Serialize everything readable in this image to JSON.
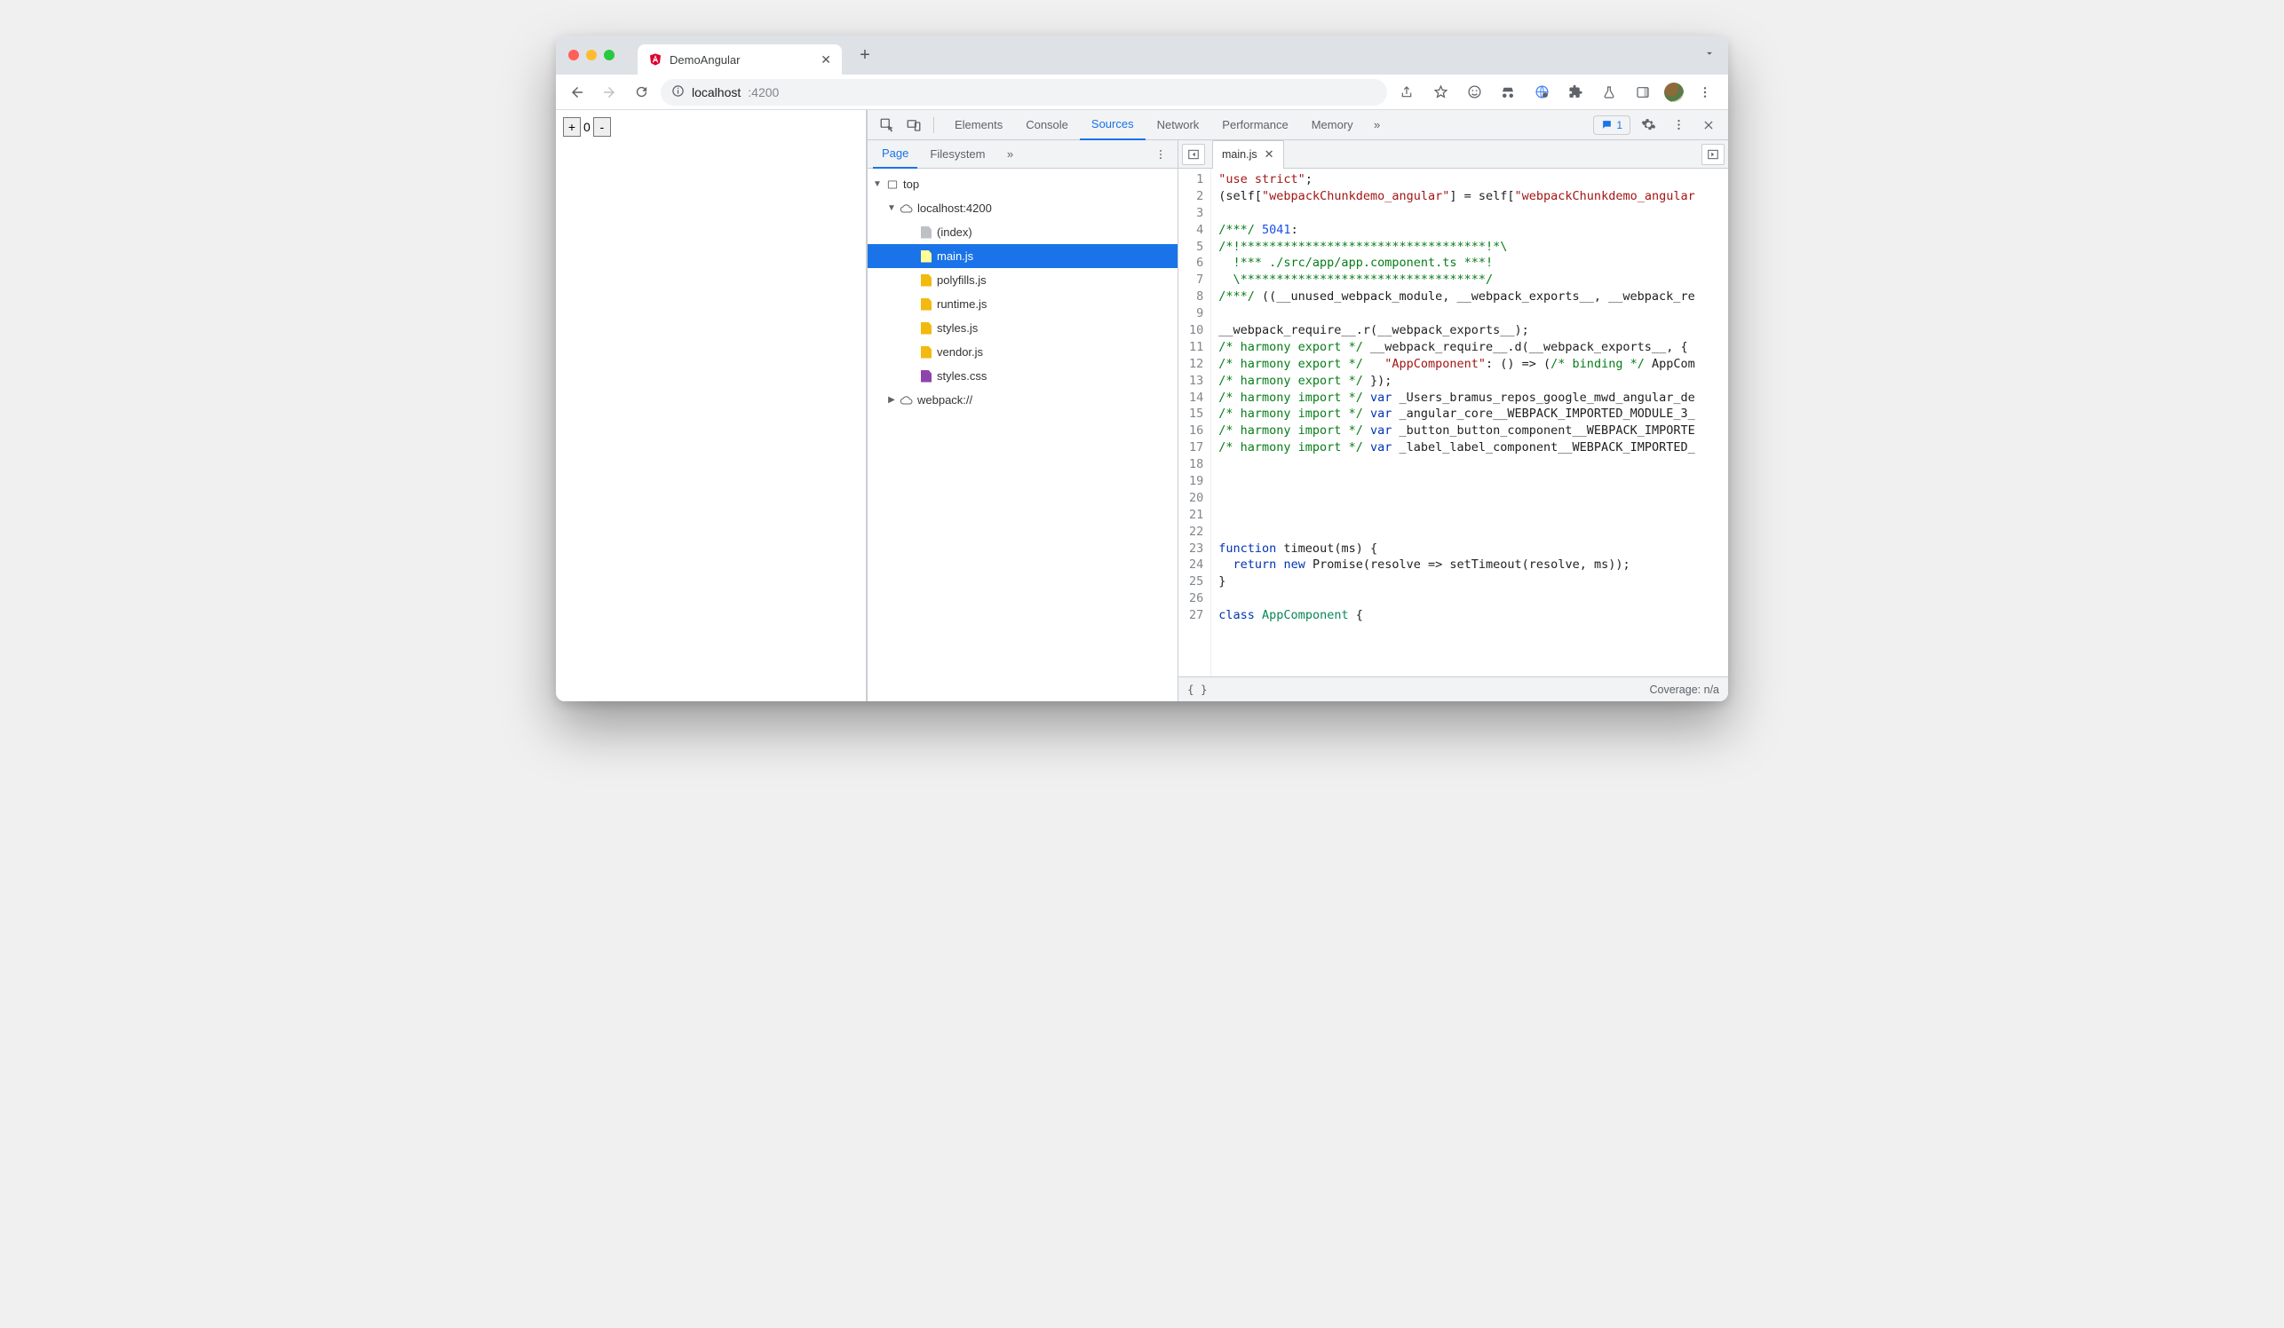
{
  "browser": {
    "tab_title": "DemoAngular",
    "url_host": "localhost",
    "url_port": ":4200"
  },
  "page": {
    "counter_value": "0"
  },
  "devtools": {
    "tabs": [
      "Elements",
      "Console",
      "Sources",
      "Network",
      "Performance",
      "Memory"
    ],
    "active_tab": "Sources",
    "message_count": "1",
    "nav": {
      "tabs": [
        "Page",
        "Filesystem"
      ],
      "active": "Page",
      "tree": {
        "top": "top",
        "origin": "localhost:4200",
        "files": [
          {
            "name": "(index)",
            "kind": "doc"
          },
          {
            "name": "main.js",
            "kind": "js",
            "selected": true
          },
          {
            "name": "polyfills.js",
            "kind": "js"
          },
          {
            "name": "runtime.js",
            "kind": "js"
          },
          {
            "name": "styles.js",
            "kind": "js"
          },
          {
            "name": "vendor.js",
            "kind": "js"
          },
          {
            "name": "styles.css",
            "kind": "css"
          }
        ],
        "webpack": "webpack://"
      }
    },
    "editor": {
      "open_file": "main.js",
      "coverage": "Coverage: n/a",
      "code": [
        {
          "n": 1,
          "segs": [
            {
              "t": "\"use strict\"",
              "c": "str"
            },
            {
              "t": ";",
              "c": "id"
            }
          ]
        },
        {
          "n": 2,
          "segs": [
            {
              "t": "(self[",
              "c": "id"
            },
            {
              "t": "\"webpackChunkdemo_angular\"",
              "c": "str"
            },
            {
              "t": "] = self[",
              "c": "id"
            },
            {
              "t": "\"webpackChunkdemo_angular",
              "c": "str"
            }
          ]
        },
        {
          "n": 3,
          "segs": []
        },
        {
          "n": 4,
          "segs": [
            {
              "t": "/***/",
              "c": "cmt"
            },
            {
              "t": " ",
              "c": "id"
            },
            {
              "t": "5041",
              "c": "num"
            },
            {
              "t": ":",
              "c": "id"
            }
          ]
        },
        {
          "n": 5,
          "segs": [
            {
              "t": "/*!**********************************!*\\",
              "c": "cmt"
            }
          ]
        },
        {
          "n": 6,
          "segs": [
            {
              "t": "  !*** ./src/app/app.component.ts ***!",
              "c": "cmt"
            }
          ]
        },
        {
          "n": 7,
          "segs": [
            {
              "t": "  \\**********************************/",
              "c": "cmt"
            }
          ]
        },
        {
          "n": 8,
          "segs": [
            {
              "t": "/***/",
              "c": "cmt"
            },
            {
              "t": " ((__unused_webpack_module, __webpack_exports__, __webpack_re",
              "c": "id"
            }
          ]
        },
        {
          "n": 9,
          "segs": []
        },
        {
          "n": 10,
          "segs": [
            {
              "t": "__webpack_require__.r(__webpack_exports__);",
              "c": "id"
            }
          ]
        },
        {
          "n": 11,
          "segs": [
            {
              "t": "/* harmony export */",
              "c": "cmt"
            },
            {
              "t": " __webpack_require__.d(__webpack_exports__, {",
              "c": "id"
            }
          ]
        },
        {
          "n": 12,
          "segs": [
            {
              "t": "/* harmony export */",
              "c": "cmt"
            },
            {
              "t": "   ",
              "c": "id"
            },
            {
              "t": "\"AppComponent\"",
              "c": "str"
            },
            {
              "t": ": () => (",
              "c": "id"
            },
            {
              "t": "/* binding */",
              "c": "cmt"
            },
            {
              "t": " AppCom",
              "c": "id"
            }
          ]
        },
        {
          "n": 13,
          "segs": [
            {
              "t": "/* harmony export */",
              "c": "cmt"
            },
            {
              "t": " });",
              "c": "id"
            }
          ]
        },
        {
          "n": 14,
          "segs": [
            {
              "t": "/* harmony import */",
              "c": "cmt"
            },
            {
              "t": " ",
              "c": "id"
            },
            {
              "t": "var",
              "c": "kw"
            },
            {
              "t": " _Users_bramus_repos_google_mwd_angular_de",
              "c": "id"
            }
          ]
        },
        {
          "n": 15,
          "segs": [
            {
              "t": "/* harmony import */",
              "c": "cmt"
            },
            {
              "t": " ",
              "c": "id"
            },
            {
              "t": "var",
              "c": "kw"
            },
            {
              "t": " _angular_core__WEBPACK_IMPORTED_MODULE_3_",
              "c": "id"
            }
          ]
        },
        {
          "n": 16,
          "segs": [
            {
              "t": "/* harmony import */",
              "c": "cmt"
            },
            {
              "t": " ",
              "c": "id"
            },
            {
              "t": "var",
              "c": "kw"
            },
            {
              "t": " _button_button_component__WEBPACK_IMPORTE",
              "c": "id"
            }
          ]
        },
        {
          "n": 17,
          "segs": [
            {
              "t": "/* harmony import */",
              "c": "cmt"
            },
            {
              "t": " ",
              "c": "id"
            },
            {
              "t": "var",
              "c": "kw"
            },
            {
              "t": " _label_label_component__WEBPACK_IMPORTED_",
              "c": "id"
            }
          ]
        },
        {
          "n": 18,
          "segs": []
        },
        {
          "n": 19,
          "segs": []
        },
        {
          "n": 20,
          "segs": []
        },
        {
          "n": 21,
          "segs": []
        },
        {
          "n": 22,
          "segs": []
        },
        {
          "n": 23,
          "segs": [
            {
              "t": "function",
              "c": "kw"
            },
            {
              "t": " timeout(ms) {",
              "c": "id"
            }
          ]
        },
        {
          "n": 24,
          "segs": [
            {
              "t": "  ",
              "c": "id"
            },
            {
              "t": "return",
              "c": "kw"
            },
            {
              "t": " ",
              "c": "id"
            },
            {
              "t": "new",
              "c": "kw"
            },
            {
              "t": " Promise(resolve => setTimeout(resolve, ms));",
              "c": "id"
            }
          ]
        },
        {
          "n": 25,
          "segs": [
            {
              "t": "}",
              "c": "id"
            }
          ]
        },
        {
          "n": 26,
          "segs": []
        },
        {
          "n": 27,
          "segs": [
            {
              "t": "class",
              "c": "kw"
            },
            {
              "t": " ",
              "c": "id"
            },
            {
              "t": "AppComponent",
              "c": "bind2"
            },
            {
              "t": " {",
              "c": "id"
            }
          ]
        }
      ]
    }
  }
}
